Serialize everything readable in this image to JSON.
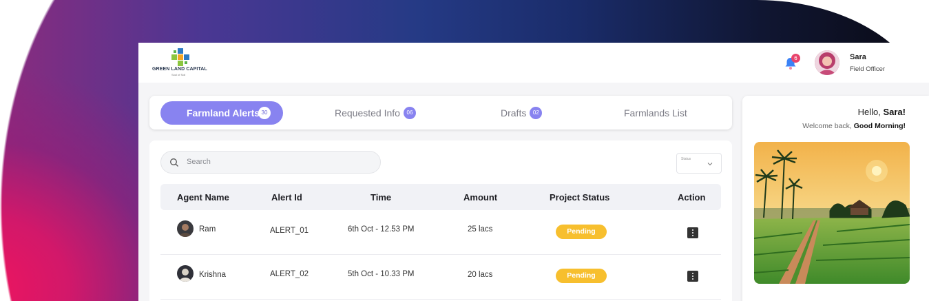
{
  "brand": {
    "name": "GREEN LAND CAPITAL",
    "tagline": "Soul of Soil"
  },
  "header": {
    "notification_count": "6",
    "user_name": "Sara",
    "user_role": "Field Officer"
  },
  "tabs": [
    {
      "label": "Farmland Alerts",
      "count": "30",
      "active": true
    },
    {
      "label": "Requested Info",
      "count": "06"
    },
    {
      "label": "Drafts",
      "count": "02"
    },
    {
      "label": "Farmlands List"
    }
  ],
  "search": {
    "placeholder": "Search"
  },
  "filter": {
    "label": "Status"
  },
  "table": {
    "headers": [
      "Agent Name",
      "Alert Id",
      "Time",
      "Amount",
      "Project Status",
      "Action"
    ],
    "rows": [
      {
        "agent": "Ram",
        "alert_id": "ALERT_01",
        "time": "6th Oct - 12.53 PM",
        "amount": "25 lacs",
        "status": "Pending"
      },
      {
        "agent": "Krishna",
        "alert_id": "ALERT_02",
        "time": "5th Oct - 10.33 PM",
        "amount": "20 lacs",
        "status": "Pending"
      }
    ]
  },
  "greeting": {
    "hello": "Hello,",
    "name": "Sara!",
    "welcome": "Welcome back,",
    "time_of_day": "Good Morning!"
  },
  "colors": {
    "accent": "#8883f0",
    "pending": "#f7bf2e",
    "notification": "#e8436b"
  }
}
